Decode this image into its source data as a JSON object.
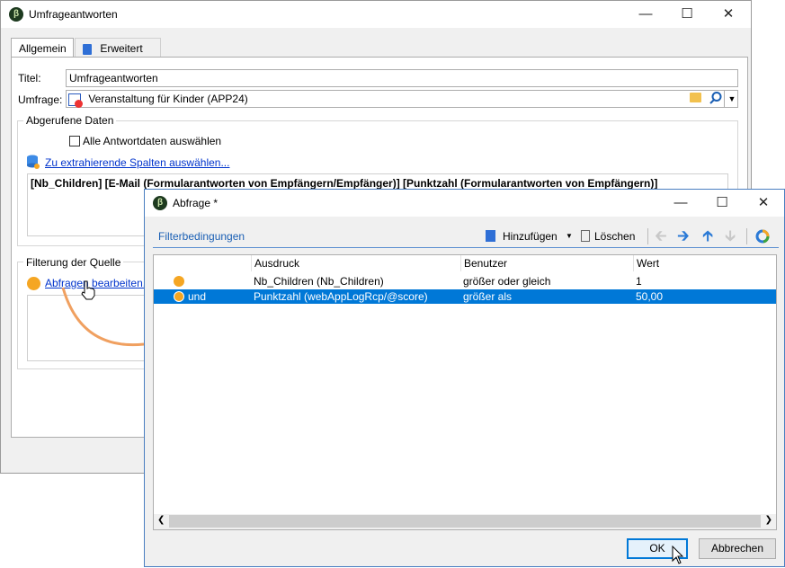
{
  "main_window": {
    "title": "Umfrageantworten",
    "tabs": [
      {
        "label": "Allgemein"
      },
      {
        "label": "Erweitert"
      }
    ],
    "titel_label": "Titel:",
    "titel_value": "Umfrageantworten",
    "umfrage_label": "Umfrage:",
    "umfrage_value": "Veranstaltung für Kinder (APP24)",
    "abgerufene_daten": {
      "title": "Abgerufene Daten",
      "checkbox_label": "Alle Antwortdaten auswählen",
      "link": "Zu extrahierende Spalten auswählen...",
      "columns_text": "[Nb_Children]  [E-Mail (Formularantworten von Empfängern/Empfänger)]  [Punktzahl (Formularantworten von Empfängern)]"
    },
    "filterung": {
      "title": "Filterung der Quelle",
      "link": "Abfragen bearbeiten..."
    }
  },
  "query_dialog": {
    "title": "Abfrage *",
    "toolbar": {
      "filter_label": "Filterbedingungen",
      "add_label": "Hinzufügen",
      "delete_label": "Löschen"
    },
    "columns": [
      "Ausdruck",
      "Benutzer",
      "Wert"
    ],
    "rows": [
      {
        "prefix": "",
        "expression": "Nb_Children (Nb_Children)",
        "operator": "größer oder gleich",
        "value": "1"
      },
      {
        "prefix": "und",
        "expression": "Punktzahl (webAppLogRcp/@score)",
        "operator": "größer als",
        "value": "50,00"
      }
    ],
    "ok_label": "OK",
    "cancel_label": "Abbrechen"
  },
  "colors": {
    "accent": "#0078d7",
    "link": "#0033cc",
    "orange": "#f5a623",
    "arrow": "#f0a060"
  }
}
